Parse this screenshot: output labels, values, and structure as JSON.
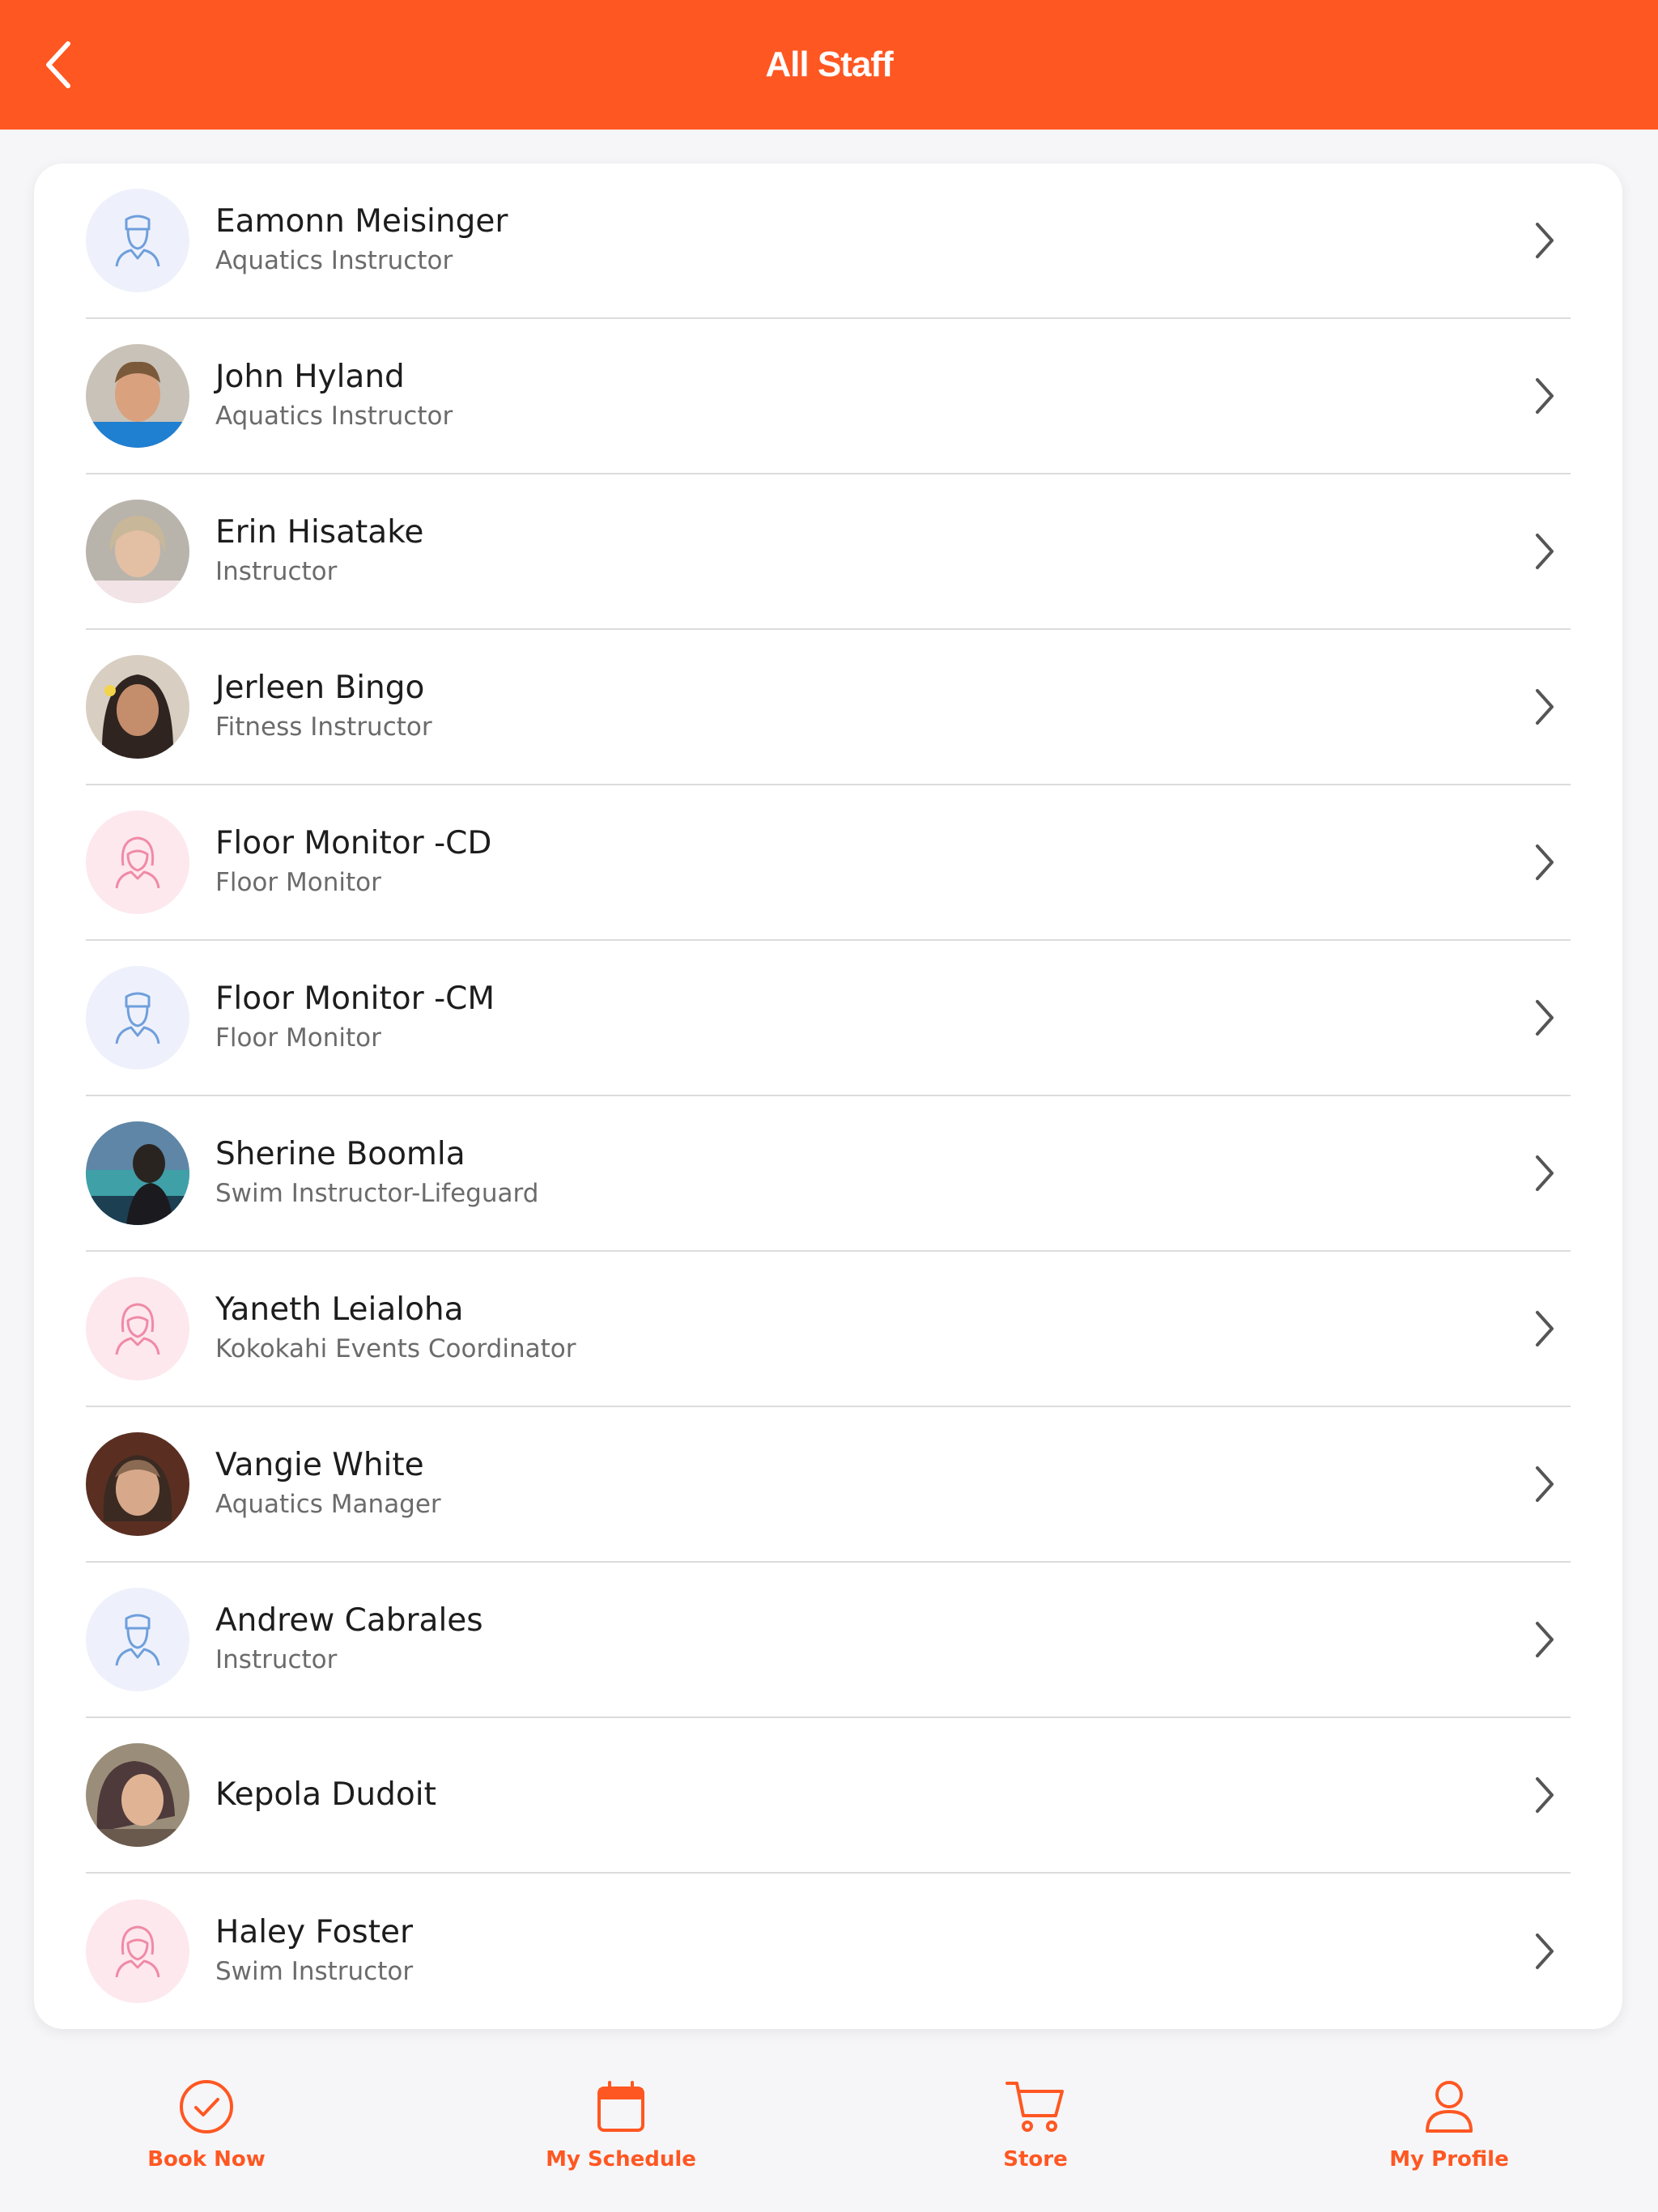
{
  "header": {
    "title": "All Staff",
    "back_icon": "chevron-left-icon"
  },
  "staff": [
    {
      "name": "Eamonn Meisinger",
      "role": "Aquatics Instructor",
      "avatar": "male-placeholder"
    },
    {
      "name": "John Hyland",
      "role": "Aquatics Instructor",
      "avatar": "photo"
    },
    {
      "name": "Erin Hisatake",
      "role": "Instructor",
      "avatar": "photo"
    },
    {
      "name": "Jerleen Bingo",
      "role": "Fitness Instructor",
      "avatar": "photo"
    },
    {
      "name": "Floor Monitor -CD",
      "role": "Floor Monitor",
      "avatar": "female-placeholder"
    },
    {
      "name": "Floor Monitor -CM",
      "role": "Floor Monitor",
      "avatar": "male-placeholder"
    },
    {
      "name": "Sherine Boomla",
      "role": "Swim Instructor-Lifeguard",
      "avatar": "photo"
    },
    {
      "name": "Yaneth Leialoha",
      "role": "Kokokahi Events Coordinator",
      "avatar": "female-placeholder"
    },
    {
      "name": "Vangie White",
      "role": "Aquatics Manager",
      "avatar": "photo"
    },
    {
      "name": "Andrew Cabrales",
      "role": "Instructor",
      "avatar": "male-placeholder"
    },
    {
      "name": "Kepola Dudoit",
      "role": "",
      "avatar": "photo"
    },
    {
      "name": "Haley Foster",
      "role": "Swim Instructor",
      "avatar": "female-placeholder"
    }
  ],
  "tabbar": {
    "book_now": "Book Now",
    "my_schedule": "My Schedule",
    "store": "Store",
    "my_profile": "My Profile"
  },
  "colors": {
    "accent": "#ff5722",
    "male_bg": "#eef1fb",
    "female_bg": "#fde8ee",
    "male_icon": "#6f9fdc",
    "female_icon": "#f08aa6"
  }
}
